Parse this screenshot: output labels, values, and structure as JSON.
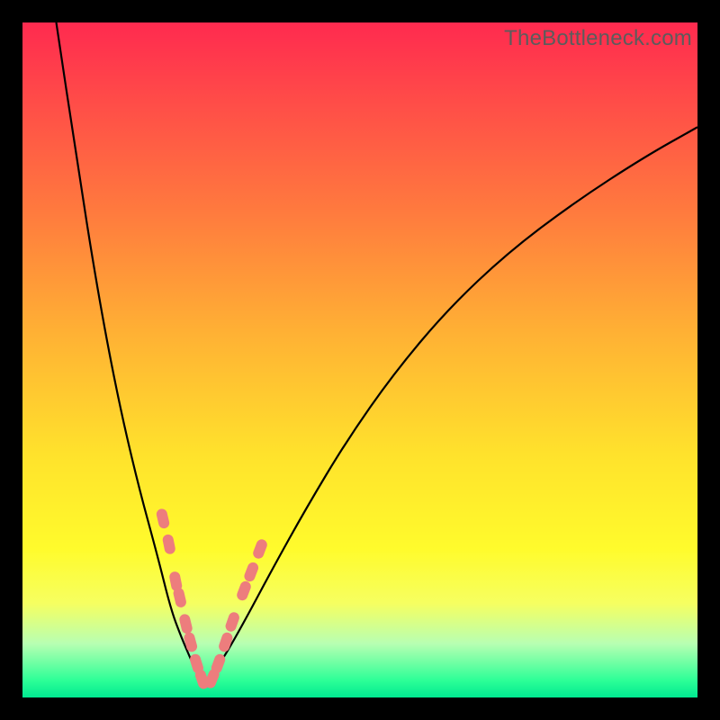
{
  "watermark": "TheBottleneck.com",
  "colors": {
    "frame_bg_top": "#ff2a4f",
    "frame_bg_mid": "#ffe22c",
    "frame_bg_bottom": "#00e890",
    "curve": "#000000",
    "marker_fill": "#ed7d7d",
    "page_bg": "#000000"
  },
  "chart_data": {
    "type": "line",
    "title": "",
    "xlabel": "",
    "ylabel": "",
    "xlim": [
      0,
      100
    ],
    "ylim": [
      0,
      100
    ],
    "grid": false,
    "legend": false,
    "series": [
      {
        "name": "left-branch",
        "x": [
          5,
          8,
          11,
          14,
          17,
          20,
          22,
          23.5,
          25,
          26,
          26.7
        ],
        "values": [
          100,
          80,
          61,
          45,
          32,
          21,
          13,
          9,
          5.5,
          3.2,
          2.2
        ]
      },
      {
        "name": "right-branch",
        "x": [
          26.7,
          28,
          30,
          33,
          37,
          42,
          48,
          55,
          63,
          72,
          82,
          92,
          100
        ],
        "values": [
          2.2,
          3.3,
          6.2,
          11.5,
          19,
          28,
          38,
          48,
          57.5,
          66,
          73.5,
          80,
          84.5
        ]
      }
    ],
    "markers": {
      "name": "left-branch-highlight",
      "style": "pill",
      "color": "#ed7d7d",
      "points_left": [
        {
          "x": 20.8,
          "y": 26.5
        },
        {
          "x": 21.7,
          "y": 22.7
        },
        {
          "x": 22.7,
          "y": 17.2
        },
        {
          "x": 23.3,
          "y": 14.8
        },
        {
          "x": 24.2,
          "y": 10.9
        },
        {
          "x": 24.9,
          "y": 8.2
        },
        {
          "x": 25.8,
          "y": 5.0
        },
        {
          "x": 26.6,
          "y": 2.7
        }
      ],
      "points_right": [
        {
          "x": 28.1,
          "y": 2.8
        },
        {
          "x": 29.0,
          "y": 5.0
        },
        {
          "x": 30.1,
          "y": 8.2
        },
        {
          "x": 31.1,
          "y": 11.2
        },
        {
          "x": 32.8,
          "y": 15.8
        },
        {
          "x": 33.9,
          "y": 18.6
        },
        {
          "x": 35.2,
          "y": 22.0
        }
      ]
    }
  }
}
